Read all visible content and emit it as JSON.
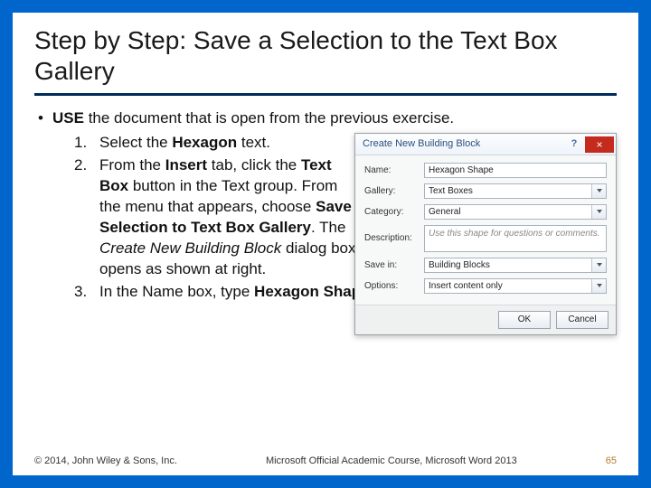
{
  "title": "Step by Step: Save a Selection to the Text Box Gallery",
  "lead_pre": "USE",
  "lead_post": " the document that is open from the previous exercise.",
  "step1_pre": "Select the ",
  "step1_b": "Hexagon",
  "step1_post": " text.",
  "step2_a": "From the ",
  "step2_b1": "Insert",
  "step2_c": " tab, click the ",
  "step2_b2": "Text Box",
  "step2_d": " button in the Text group. From the menu that appears, choose ",
  "step2_b3": "Save Selection to Text Box Gallery",
  "step2_e": ". The ",
  "step2_i": "Create New Building Block",
  "step2_f": " dialog box opens as shown at right.",
  "step3_a": "In the Name box, type ",
  "step3_b": "Hexagon Shape",
  "step3_c": ".",
  "dialog": {
    "title": "Create New Building Block",
    "help": "?",
    "close": "×",
    "labels": {
      "name": "Name:",
      "gallery": "Gallery:",
      "category": "Category:",
      "description": "Description:",
      "savein": "Save in:",
      "options": "Options:"
    },
    "values": {
      "name": "Hexagon Shape",
      "gallery": "Text Boxes",
      "category": "General",
      "description": "Use this shape for questions or comments.",
      "savein": "Building Blocks",
      "options": "Insert content only"
    },
    "ok": "OK",
    "cancel": "Cancel"
  },
  "footer": {
    "left": "© 2014, John Wiley & Sons, Inc.",
    "center": "Microsoft Official Academic Course, Microsoft Word 2013",
    "page": "65"
  }
}
